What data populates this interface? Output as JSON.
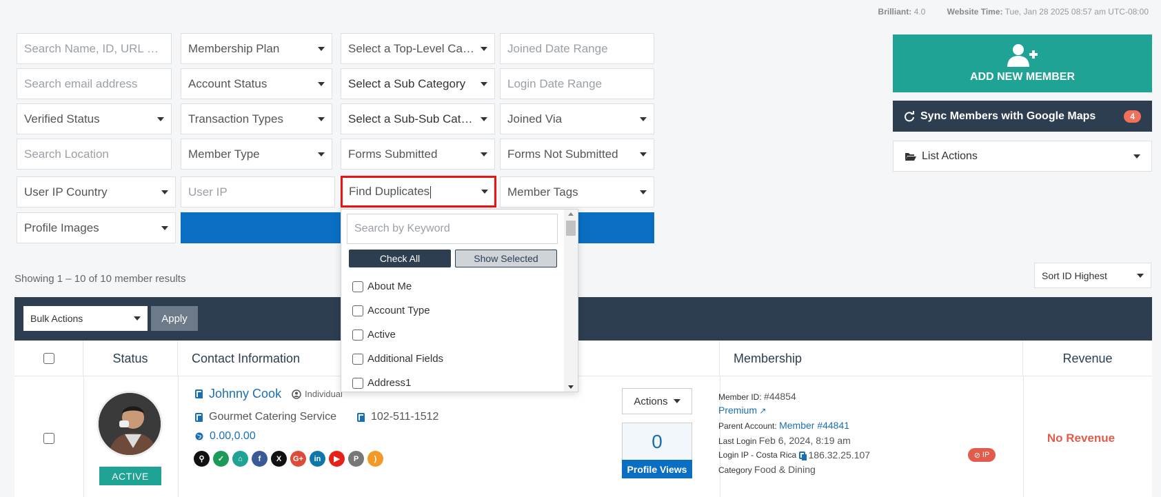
{
  "header": {
    "brilliant_label": "Brilliant:",
    "brilliant_value": "4.0",
    "time_label": "Website Time:",
    "time_value": "Tue, Jan 28 2025 08:57 am UTC-08:00"
  },
  "filters": {
    "search_name": "Search Name, ID, URL or Tc",
    "membership_plan": "Membership Plan",
    "top_category": "Select a Top-Level Cat...",
    "joined_date": "Joined Date Range",
    "search_email": "Search email address",
    "account_status": "Account Status",
    "sub_category": "Select a Sub Category",
    "login_date": "Login Date Range",
    "verified_status": "Verified Status",
    "transaction_types": "Transaction Types",
    "sub_sub_category": "Select a Sub-Sub Cate...",
    "joined_via": "Joined Via",
    "search_location": "Search Location",
    "member_type": "Member Type",
    "forms_submitted": "Forms Submitted",
    "forms_not_submitted": "Forms Not Submitted",
    "user_ip_country": "User IP Country",
    "user_ip": "User IP",
    "find_duplicates": "Find Duplicates",
    "member_tags": "Member Tags",
    "profile_images": "Profile Images"
  },
  "side": {
    "add_member": "ADD NEW MEMBER",
    "sync_label": "Sync Members with Google Maps",
    "sync_badge": "4",
    "list_actions": "List Actions"
  },
  "results": {
    "showing": "Showing 1 – 10 of 10 member results",
    "sort": "Sort ID Highest",
    "bulk_actions": "Bulk Actions",
    "apply": "Apply"
  },
  "table": {
    "columns": [
      "Status",
      "Contact Information",
      "Membership",
      "Revenue"
    ]
  },
  "member": {
    "status": "ACTIVE",
    "name": "Johnny Cook",
    "type": "Individual",
    "company": "Gourmet Catering Service",
    "phone": "102-511-1512",
    "coords": "0.00,0.00",
    "actions": "Actions",
    "profile_views_count": "0",
    "profile_views_label": "Profile Views",
    "member_id_label": "Member ID:",
    "member_id": "#44854",
    "plan": "Premium",
    "parent_label": "Parent Account:",
    "parent_value": "Member #44841",
    "last_login_label": "Last Login",
    "last_login_value": "Feb 6, 2024, 8:19 am",
    "login_ip_label": "Login IP - Costa Rica",
    "login_ip_value": "186.32.25.107",
    "ip_badge": "IP",
    "category_label": "Category",
    "category_value": "Food & Dining",
    "revenue": "No Revenue"
  },
  "dropdown": {
    "search_placeholder": "Search by Keyword",
    "check_all": "Check All",
    "show_selected": "Show Selected",
    "items": [
      "About Me",
      "Account Type",
      "Active",
      "Additional Fields",
      "Address1"
    ]
  },
  "colors": {
    "teal": "#1fa394",
    "navy": "#2c3e50",
    "blue": "#0a6fc2",
    "red": "#e35b4a",
    "highlight": "#e11111"
  }
}
